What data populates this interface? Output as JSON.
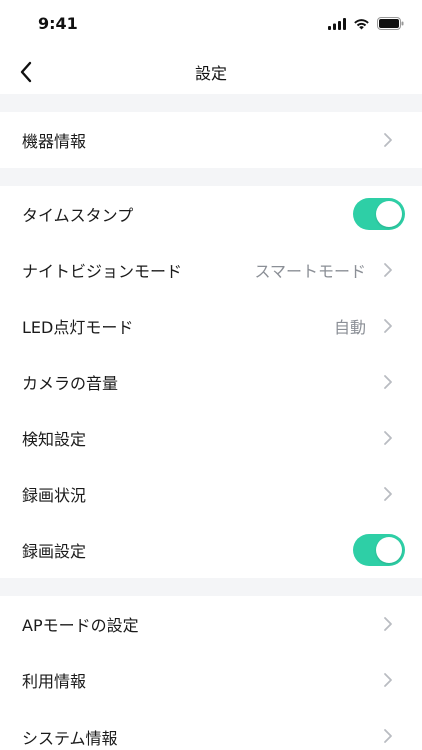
{
  "status_bar": {
    "time": "9:41",
    "icons": [
      "cellular-signal-icon",
      "wifi-icon",
      "battery-icon"
    ]
  },
  "header": {
    "title": "設定",
    "back_icon": "chevron-left-icon"
  },
  "colors": {
    "toggle_on": "#2ecfa6",
    "section_gap": "#f4f5f7",
    "value_text": "#8b8f96",
    "chevron": "#b9bcc2"
  },
  "sections": [
    {
      "items": [
        {
          "label": "機器情報",
          "type": "link"
        }
      ]
    },
    {
      "items": [
        {
          "label": "タイムスタンプ",
          "type": "toggle",
          "on": true
        },
        {
          "label": "ナイトビジョンモード",
          "type": "link",
          "value": "スマートモード"
        },
        {
          "label": "LED点灯モード",
          "type": "link",
          "value": "自動"
        },
        {
          "label": "カメラの音量",
          "type": "link"
        },
        {
          "label": "検知設定",
          "type": "link"
        },
        {
          "label": "録画状況",
          "type": "link"
        },
        {
          "label": "録画設定",
          "type": "toggle",
          "on": true
        }
      ]
    },
    {
      "items": [
        {
          "label": "APモードの設定",
          "type": "link"
        },
        {
          "label": "利用情報",
          "type": "link"
        },
        {
          "label": "システム情報",
          "type": "link"
        }
      ]
    }
  ]
}
